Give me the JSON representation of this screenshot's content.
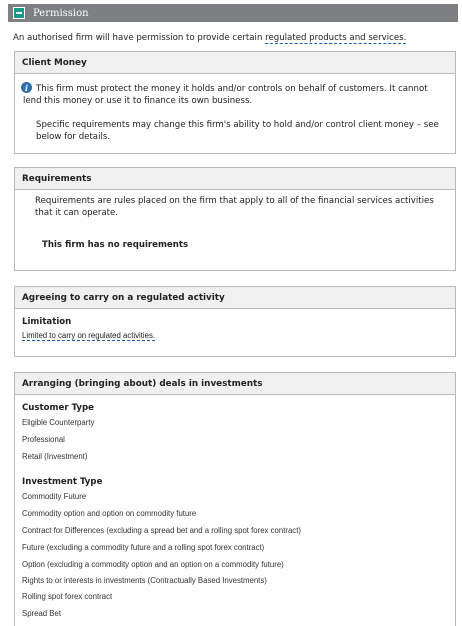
{
  "section": {
    "title": "Permission"
  },
  "intro": {
    "text": "An authorised firm will have permission to provide certain ",
    "link": "regulated products and services."
  },
  "client_money": {
    "title": "Client Money",
    "line1": "This firm must protect the money it holds and/or controls on behalf of customers. It cannot",
    "line2": "lend this money or use it to finance its own business.",
    "line3": "Specific requirements may change this firm's ability to hold and/or control client money – see",
    "line4": "below for details."
  },
  "requirements": {
    "title": "Requirements",
    "line1": "Requirements are rules placed on the firm that apply to all of the financial services activities",
    "line2": "that it can operate.",
    "none": "This firm has no requirements"
  },
  "agreeing": {
    "title": "Agreeing to carry on a regulated activity",
    "limitation_heading": "Limitation",
    "limitation_text": "Limited to carry on regulated activities."
  },
  "arranging": {
    "title": "Arranging (bringing about) deals in investments",
    "customer_type_heading": "Customer Type",
    "customer_types": [
      "Eligible Counterparty",
      "Professional",
      "Retail (Investment)"
    ],
    "investment_type_heading": "Investment Type",
    "investment_types": [
      "Commodity Future",
      "Commodity option and option on commodity future",
      "Contract for Differences (excluding a spread bet and a rolling spot forex contract)",
      "Future (excluding a commodity future and a rolling spot forex contract)",
      "Option (excluding a commodity option and an option on a commodity future)",
      "Rights to or interests in investments (Contractually Based Investments)",
      "Rolling spot forex contract",
      "Spread Bet"
    ]
  },
  "icons": {
    "collapse": "minus-icon",
    "info": "info-icon"
  },
  "colors": {
    "header_bar": "#7d7f82",
    "toggle": "#1a9a8c",
    "link_underline": "#1a5fa8",
    "panel_border": "#b9b9b9"
  }
}
